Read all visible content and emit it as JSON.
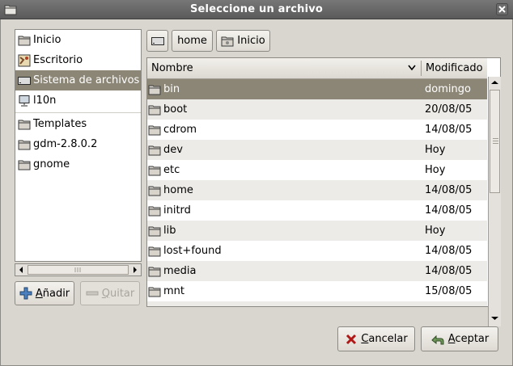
{
  "window": {
    "title": "Seleccione un archivo"
  },
  "icons": {
    "window": "folder-icon",
    "close": "close-icon",
    "folder": "folder-icon",
    "desktop": "desktop-icon",
    "filesystem": "drive-icon",
    "network": "computer-icon",
    "add": "plus-icon",
    "remove": "minus-icon",
    "cancel": "cancel-x-icon",
    "accept": "accept-icon"
  },
  "sidebar": {
    "places": [
      {
        "label": "Inicio",
        "icon": "folder-icon"
      },
      {
        "label": "Escritorio",
        "icon": "desktop-icon"
      },
      {
        "label": "Sistema de archivos",
        "icon": "drive-icon",
        "selected": true
      },
      {
        "label": "l10n",
        "icon": "computer-icon"
      }
    ],
    "bookmarks": [
      {
        "label": "Templates"
      },
      {
        "label": "gdm-2.8.0.2"
      },
      {
        "label": "gnome"
      }
    ],
    "add_label": "Añadir",
    "add_mnemonic": "A",
    "add_rest": "ñadir",
    "remove_label": "Quitar",
    "remove_mnemonic": "Q",
    "remove_rest": "uitar"
  },
  "pathbar": {
    "items": [
      "home",
      "Inicio"
    ]
  },
  "filelist": {
    "columns": {
      "name": "Nombre",
      "modified": "Modificado"
    },
    "sort_indicator": "chevron-down-icon",
    "rows": [
      {
        "name": "bin",
        "modified": "domingo"
      },
      {
        "name": "boot",
        "modified": "20/08/05"
      },
      {
        "name": "cdrom",
        "modified": "14/08/05"
      },
      {
        "name": "dev",
        "modified": "Hoy"
      },
      {
        "name": "etc",
        "modified": "Hoy"
      },
      {
        "name": "home",
        "modified": "14/08/05"
      },
      {
        "name": "initrd",
        "modified": "14/08/05"
      },
      {
        "name": "lib",
        "modified": "Hoy"
      },
      {
        "name": "lost+found",
        "modified": "14/08/05"
      },
      {
        "name": "media",
        "modified": "14/08/05"
      },
      {
        "name": "mnt",
        "modified": "15/08/05"
      }
    ]
  },
  "actions": {
    "cancel_label": "Cancelar",
    "cancel_mnemonic": "C",
    "cancel_rest": "ancelar",
    "accept_label": "Aceptar",
    "accept_mnemonic": "A",
    "accept_rest": "ceptar"
  }
}
